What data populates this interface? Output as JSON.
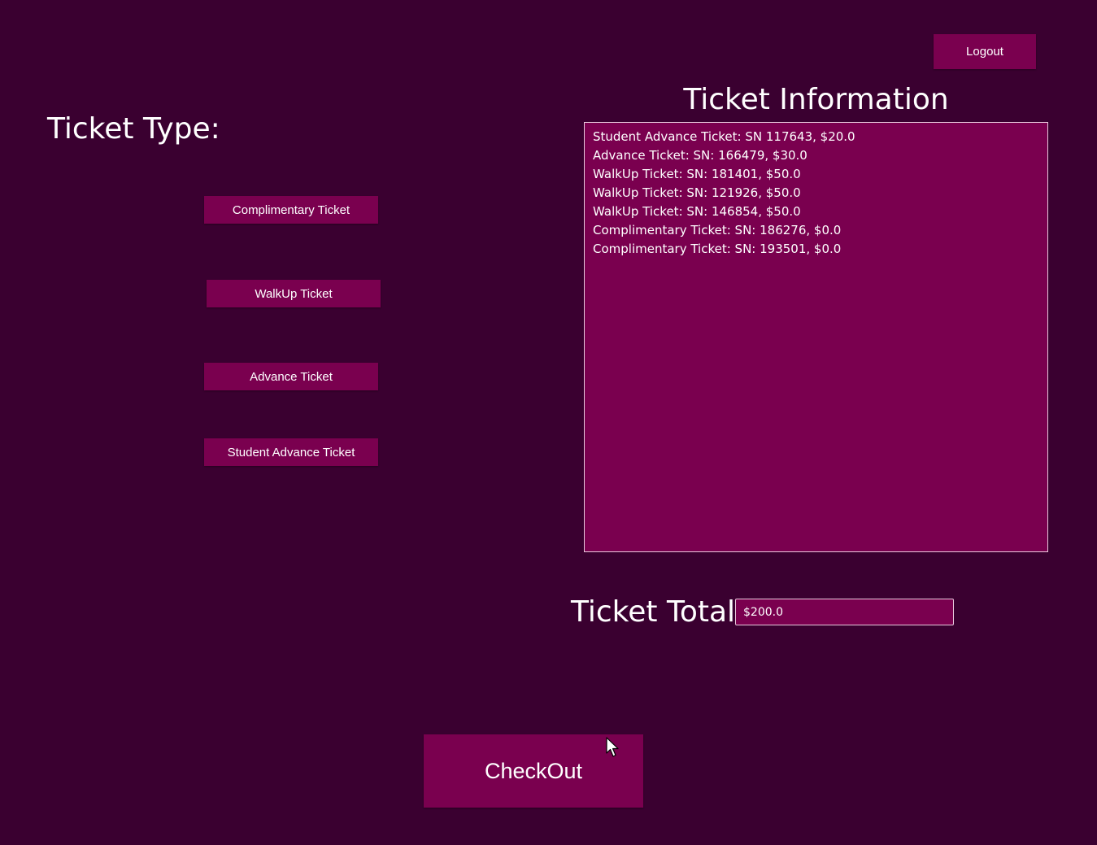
{
  "header": {
    "logout_label": "Logout"
  },
  "ticket_type": {
    "heading": "Ticket Type:",
    "buttons": [
      {
        "label": "Complimentary Ticket"
      },
      {
        "label": "WalkUp Ticket"
      },
      {
        "label": "Advance Ticket"
      },
      {
        "label": "Student Advance Ticket"
      }
    ]
  },
  "ticket_information": {
    "heading": "Ticket Information",
    "items": [
      "Student Advance Ticket: SN 117643, $20.0",
      "Advance Ticket: SN: 166479, $30.0",
      "WalkUp Ticket: SN: 181401, $50.0",
      "WalkUp Ticket: SN: 121926, $50.0",
      "WalkUp Ticket: SN: 146854, $50.0",
      "Complimentary Ticket: SN: 186276, $0.0",
      "Complimentary Ticket: SN: 193501, $0.0"
    ]
  },
  "total": {
    "label": "Ticket Total:",
    "value": "$200.0"
  },
  "checkout": {
    "label": "CheckOut"
  },
  "colors": {
    "background": "#3a0030",
    "accent": "#7a004f",
    "text": "#ffffff"
  },
  "icons": {
    "cursor": "mouse-pointer-icon"
  }
}
